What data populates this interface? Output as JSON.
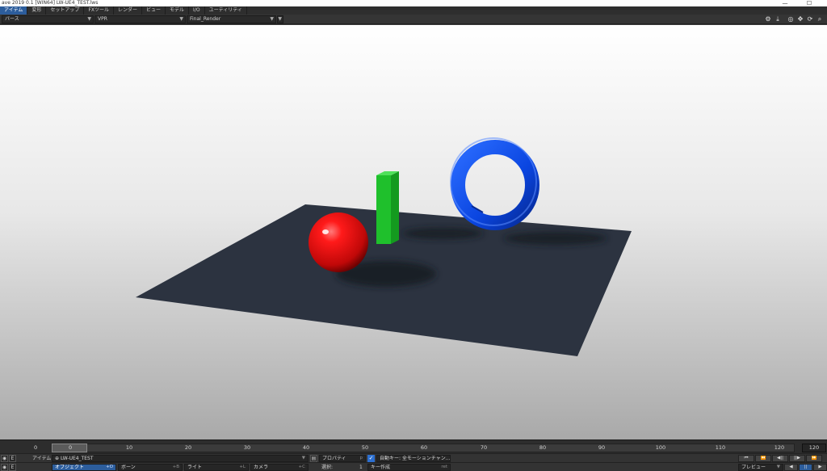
{
  "window": {
    "title": "ave 2019 0.1 [WIN64] LW-UE4_TEST.lws",
    "minimize_glyph": "—",
    "maximize_glyph": "☐"
  },
  "tabs": [
    {
      "label": "アイテム",
      "active": true
    },
    {
      "label": "変形"
    },
    {
      "label": "セットアップ"
    },
    {
      "label": "FXツール"
    },
    {
      "label": "レンダー"
    },
    {
      "label": "ビュー"
    },
    {
      "label": "モデル"
    },
    {
      "label": "I/O"
    },
    {
      "label": "ユーティリティ"
    }
  ],
  "viewport_bar": {
    "view_type": "パース",
    "render_mode": "VPR",
    "render_preset": "Final_Render",
    "icons": [
      "gear-icon",
      "save-icon",
      "camera-center-icon",
      "move-icon",
      "rotate-icon",
      "zoom-icon"
    ]
  },
  "timeline": {
    "start": "0",
    "current": "0",
    "ticks": [
      "10",
      "20",
      "30",
      "40",
      "50",
      "60",
      "70",
      "80",
      "90",
      "100",
      "110",
      "120"
    ],
    "end": "120"
  },
  "bottom_rows": {
    "row1": {
      "eye_glyph": "◉",
      "e_label": "E",
      "item_label": "アイテム",
      "item_value": "LW-UE4_TEST",
      "item_glyph": "⊕",
      "properties": "プロパティ",
      "properties_hint": "p",
      "auto_key_label": "自動キー: 全モーションチャン...",
      "playback_buttons": [
        "⏮",
        "⏪",
        "◀||",
        "||▶",
        "⏩"
      ]
    },
    "row2": {
      "eye_glyph": "◉",
      "e_label": "E",
      "objects": "オブジェクト",
      "objects_hint": "+O",
      "bones": "ボーン",
      "bones_hint": "+B",
      "lights": "ライト",
      "lights_hint": "+L",
      "cameras": "カメラ",
      "cameras_hint": "+C",
      "selected_label": "選択:",
      "selected_value": "1",
      "create_key": "キー作成",
      "create_key_hint": "ret",
      "preview": "プレビュー",
      "buttons": [
        "◀",
        "||",
        "▶"
      ]
    }
  },
  "colors": {
    "accent": "#2c5d9c",
    "sphere": "#e61010",
    "box": "#1fc02c",
    "torus": "#0a45e0",
    "floor": "#2c3340"
  }
}
